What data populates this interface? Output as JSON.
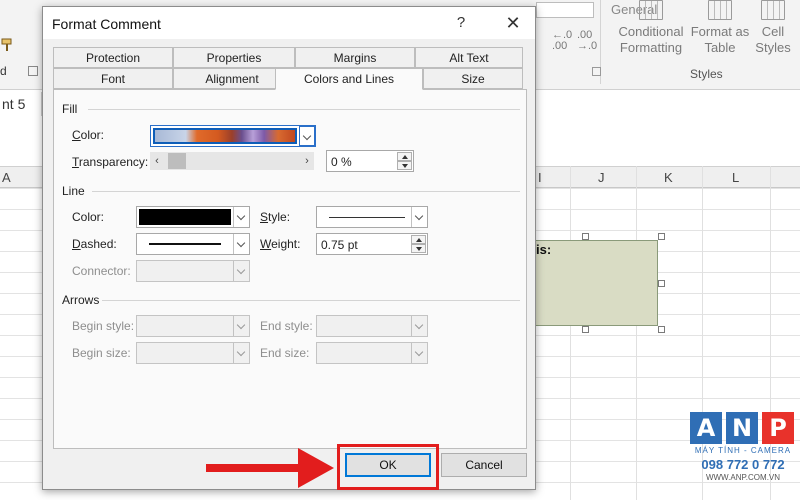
{
  "ribbon": {
    "left_group_tail": "d",
    "number_format": "General",
    "decrease_decimal": "←.0\n.00",
    "increase_decimal": ".00\n→.0",
    "conditional_formatting": [
      "Conditional",
      "Formatting"
    ],
    "format_as_table": [
      "Format as",
      "Table"
    ],
    "cell_styles": [
      "Cell",
      "Styles"
    ],
    "styles_group": "Styles"
  },
  "name_box": "nt 5",
  "columns": [
    "A",
    "I",
    "J",
    "K",
    "L"
  ],
  "comment_text": "is:",
  "logo": {
    "letters": [
      "A",
      "N",
      "P"
    ],
    "colors": [
      "#2f6eb5",
      "#2f6eb5",
      "#e8322b"
    ],
    "subtitle": "MÁY TÍNH - CAMERA",
    "phone": "098 772 0 772",
    "website": "WWW.ANP.COM.VN"
  },
  "dialog": {
    "title": "Format Comment",
    "help": "?",
    "close": "✕",
    "tabs_back": [
      "Protection",
      "Properties",
      "Margins",
      "Alt Text"
    ],
    "tabs_front": [
      "Font",
      "Alignment",
      "Colors and Lines",
      "Size"
    ],
    "active_tab": "Colors and Lines",
    "fill": {
      "group": "Fill",
      "color_label": "Color:",
      "transparency_label": "Transparency:",
      "transparency_value": "0 %"
    },
    "line": {
      "group": "Line",
      "color_label": "Color:",
      "color_value": "#000000",
      "style_label": "Style:",
      "dashed_label": "Dashed:",
      "weight_label": "Weight:",
      "weight_value": "0.75 pt",
      "connector_label": "Connector:"
    },
    "arrows": {
      "group": "Arrows",
      "begin_style": "Begin style:",
      "end_style": "End style:",
      "begin_size": "Begin size:",
      "end_size": "End size:"
    },
    "ok": "OK",
    "cancel": "Cancel"
  },
  "annotation": {
    "color": "#e21d1d"
  }
}
